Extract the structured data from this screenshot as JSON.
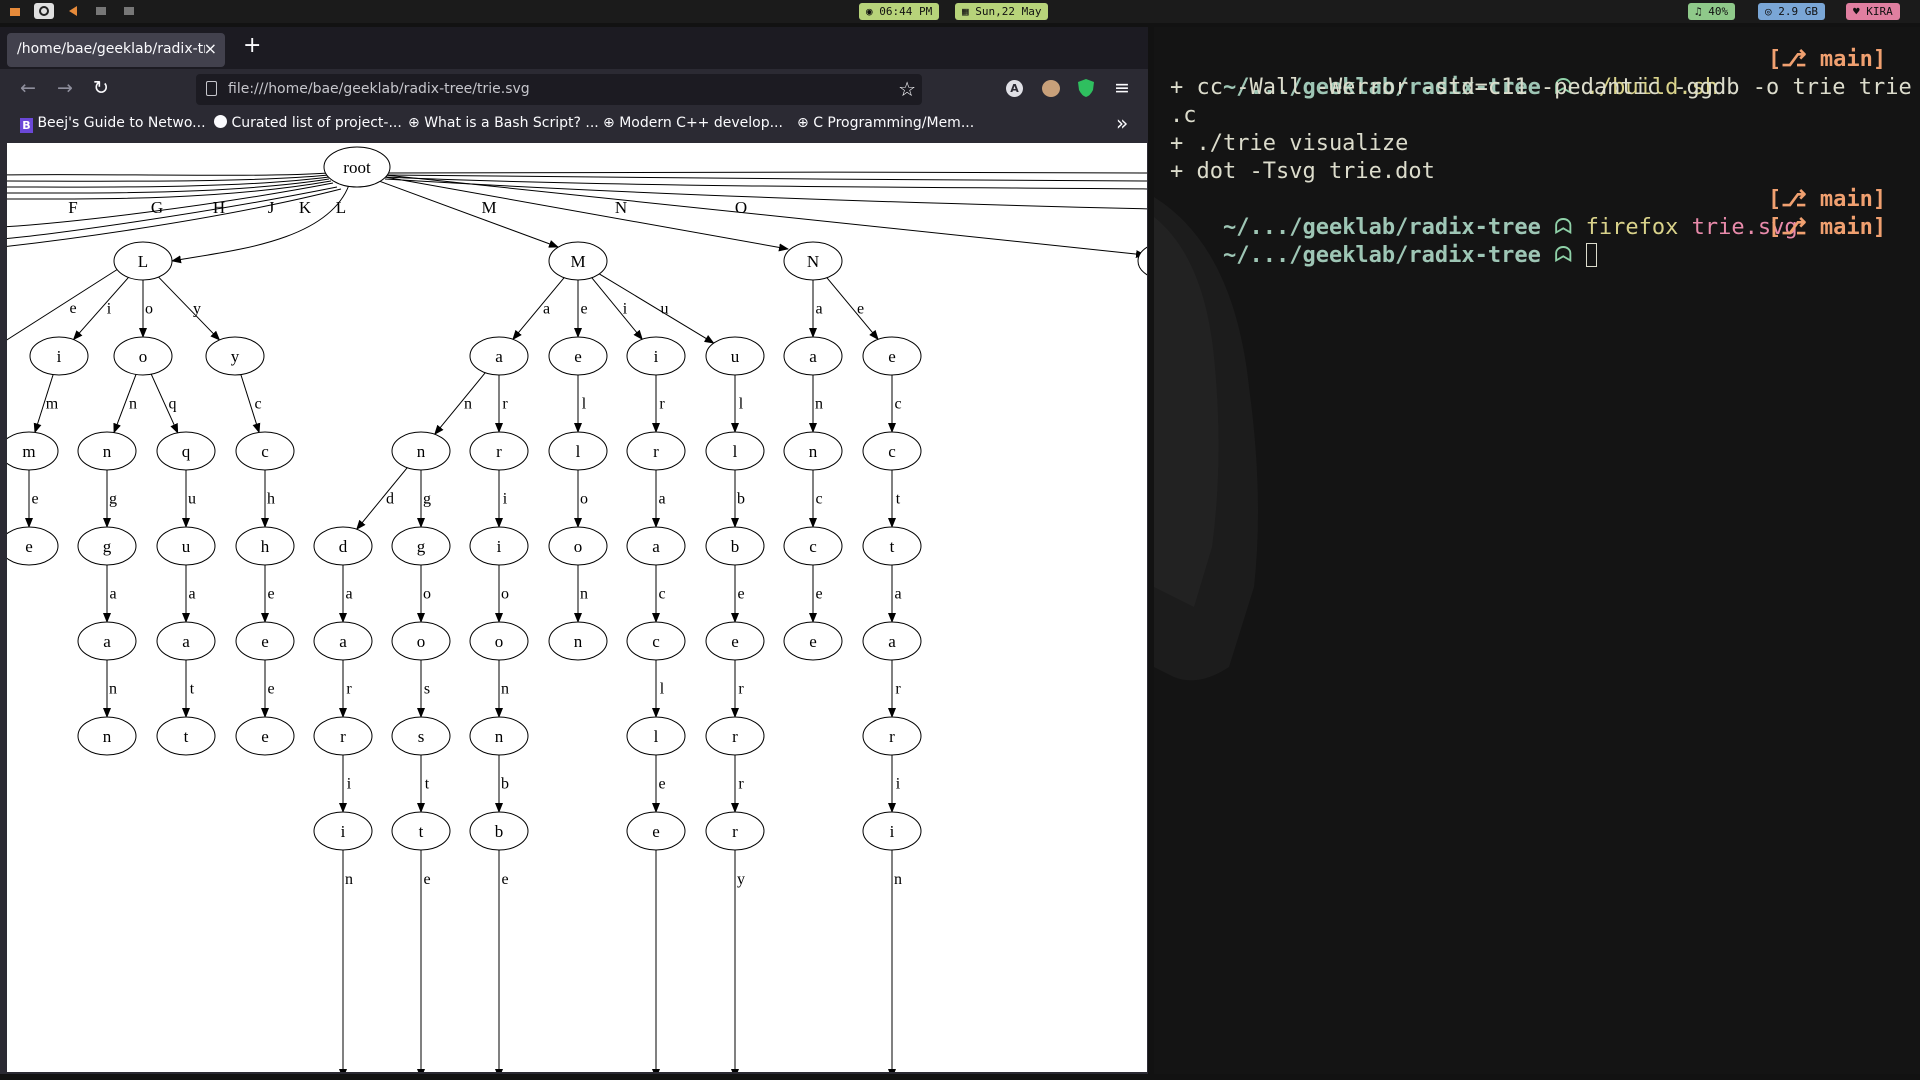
{
  "topbar": {
    "time": "06:44 PM",
    "date": "Sun,22 May",
    "audio": "40%",
    "memory": "2.9 GB",
    "user": "KIRA"
  },
  "browser": {
    "tab_title": "/home/bae/geeklab/radix-tree/trie.svg",
    "tab_close": "×",
    "new_tab": "+",
    "url": "file:///home/bae/geeklab/radix-tree/trie.svg",
    "bookmarks": [
      {
        "label": "Beej's Guide to Netwo..."
      },
      {
        "label": "Curated list of project-..."
      },
      {
        "label": "What is a Bash Script? ..."
      },
      {
        "label": "Modern C++ develop..."
      },
      {
        "label": "C Programming/Mem..."
      }
    ],
    "overflow": "»"
  },
  "graph": {
    "root": "root",
    "top_edge_labels": [
      "F",
      "G",
      "H",
      "J",
      "K",
      "L",
      "M",
      "N",
      "O"
    ],
    "nodes": [
      {
        "id": "L",
        "label": "L"
      },
      {
        "id": "M",
        "label": "M"
      },
      {
        "id": "N",
        "label": "N"
      },
      {
        "id": "Li",
        "label": "i"
      },
      {
        "id": "Lo",
        "label": "o"
      },
      {
        "id": "Ly",
        "label": "y"
      },
      {
        "id": "Lim",
        "label": "m"
      },
      {
        "id": "Lime",
        "label": "e"
      },
      {
        "id": "Lon",
        "label": "n"
      },
      {
        "id": "Long",
        "label": "g"
      },
      {
        "id": "Longa",
        "label": "a"
      },
      {
        "id": "Longan",
        "label": "n"
      },
      {
        "id": "Loq",
        "label": "q"
      },
      {
        "id": "Loqu",
        "label": "u"
      },
      {
        "id": "Loqua",
        "label": "a"
      },
      {
        "id": "Loquat",
        "label": "t"
      },
      {
        "id": "Lyc",
        "label": "c"
      },
      {
        "id": "Lych",
        "label": "h"
      },
      {
        "id": "Lyche",
        "label": "e"
      },
      {
        "id": "Lychee",
        "label": "e"
      },
      {
        "id": "Ma",
        "label": "a"
      },
      {
        "id": "Me",
        "label": "e"
      },
      {
        "id": "Mi",
        "label": "i"
      },
      {
        "id": "Mu",
        "label": "u"
      },
      {
        "id": "Man",
        "label": "n"
      },
      {
        "id": "Mand",
        "label": "d"
      },
      {
        "id": "Manda",
        "label": "a"
      },
      {
        "id": "Mandar",
        "label": "r"
      },
      {
        "id": "Mandari",
        "label": "i"
      },
      {
        "id": "Mang",
        "label": "g"
      },
      {
        "id": "Mango",
        "label": "o"
      },
      {
        "id": "Mangos",
        "label": "s"
      },
      {
        "id": "Mangost",
        "label": "t"
      },
      {
        "id": "Mar",
        "label": "r"
      },
      {
        "id": "Mari",
        "label": "i"
      },
      {
        "id": "Mario",
        "label": "o"
      },
      {
        "id": "Marion",
        "label": "n"
      },
      {
        "id": "Marionb",
        "label": "b"
      },
      {
        "id": "Mel",
        "label": "l"
      },
      {
        "id": "Melo",
        "label": "o"
      },
      {
        "id": "Melon",
        "label": "n"
      },
      {
        "id": "Mir",
        "label": "r"
      },
      {
        "id": "Mira",
        "label": "a"
      },
      {
        "id": "Mirac",
        "label": "c"
      },
      {
        "id": "Miracl",
        "label": "l"
      },
      {
        "id": "Miracle",
        "label": "e"
      },
      {
        "id": "Mul",
        "label": "l"
      },
      {
        "id": "Mulb",
        "label": "b"
      },
      {
        "id": "Mulbe",
        "label": "e"
      },
      {
        "id": "Mulber",
        "label": "r"
      },
      {
        "id": "Mulberr",
        "label": "r"
      },
      {
        "id": "Na",
        "label": "a"
      },
      {
        "id": "Nan",
        "label": "n"
      },
      {
        "id": "Nanc",
        "label": "c"
      },
      {
        "id": "Nance",
        "label": "e"
      },
      {
        "id": "Ne",
        "label": "e"
      },
      {
        "id": "Nec",
        "label": "c"
      },
      {
        "id": "Nect",
        "label": "t"
      },
      {
        "id": "Necta",
        "label": "a"
      },
      {
        "id": "Nectar",
        "label": "r"
      },
      {
        "id": "Nectari",
        "label": "i"
      }
    ],
    "edges": [
      {
        "from": "L",
        "to": "Li",
        "label": "i"
      },
      {
        "from": "L",
        "to": "Lo",
        "label": "o"
      },
      {
        "from": "L",
        "to": "Ly",
        "label": "y"
      },
      {
        "from": "Li",
        "to": "Lim",
        "label": "m"
      },
      {
        "from": "Lim",
        "to": "Lime",
        "label": "e"
      },
      {
        "from": "Lo",
        "to": "Lon",
        "label": "n"
      },
      {
        "from": "Lo",
        "to": "Loq",
        "label": "q"
      },
      {
        "from": "Lon",
        "to": "Long",
        "label": "g"
      },
      {
        "from": "Long",
        "to": "Longa",
        "label": "a"
      },
      {
        "from": "Longa",
        "to": "Longan",
        "label": "n"
      },
      {
        "from": "Loq",
        "to": "Loqu",
        "label": "u"
      },
      {
        "from": "Loqu",
        "to": "Loqua",
        "label": "a"
      },
      {
        "from": "Loqua",
        "to": "Loquat",
        "label": "t"
      },
      {
        "from": "Ly",
        "to": "Lyc",
        "label": "c"
      },
      {
        "from": "Lyc",
        "to": "Lych",
        "label": "h"
      },
      {
        "from": "Lych",
        "to": "Lyche",
        "label": "e"
      },
      {
        "from": "Lyche",
        "to": "Lychee",
        "label": "e"
      },
      {
        "from": "M",
        "to": "Ma",
        "label": "a"
      },
      {
        "from": "M",
        "to": "Me",
        "label": "e"
      },
      {
        "from": "M",
        "to": "Mi",
        "label": "i"
      },
      {
        "from": "M",
        "to": "Mu",
        "label": "u"
      },
      {
        "from": "Ma",
        "to": "Man",
        "label": "n"
      },
      {
        "from": "Ma",
        "to": "Mar",
        "label": "r"
      },
      {
        "from": "Man",
        "to": "Mand",
        "label": "d"
      },
      {
        "from": "Man",
        "to": "Mang",
        "label": "g"
      },
      {
        "from": "Mand",
        "to": "Manda",
        "label": "a"
      },
      {
        "from": "Manda",
        "to": "Mandar",
        "label": "r"
      },
      {
        "from": "Mandar",
        "to": "Mandari",
        "label": "i"
      },
      {
        "from": "Mang",
        "to": "Mango",
        "label": "o"
      },
      {
        "from": "Mango",
        "to": "Mangos",
        "label": "s"
      },
      {
        "from": "Mangos",
        "to": "Mangost",
        "label": "t"
      },
      {
        "from": "Mar",
        "to": "Mari",
        "label": "i"
      },
      {
        "from": "Mari",
        "to": "Mario",
        "label": "o"
      },
      {
        "from": "Mario",
        "to": "Marion",
        "label": "n"
      },
      {
        "from": "Marion",
        "to": "Marionb",
        "label": "b"
      },
      {
        "from": "Me",
        "to": "Mel",
        "label": "l"
      },
      {
        "from": "Mel",
        "to": "Melo",
        "label": "o"
      },
      {
        "from": "Melo",
        "to": "Melon",
        "label": "n"
      },
      {
        "from": "Mi",
        "to": "Mir",
        "label": "r"
      },
      {
        "from": "Mir",
        "to": "Mira",
        "label": "a"
      },
      {
        "from": "Mira",
        "to": "Mirac",
        "label": "c"
      },
      {
        "from": "Mirac",
        "to": "Miracl",
        "label": "l"
      },
      {
        "from": "Miracl",
        "to": "Miracle",
        "label": "e"
      },
      {
        "from": "Mu",
        "to": "Mul",
        "label": "l"
      },
      {
        "from": "Mul",
        "to": "Mulb",
        "label": "b"
      },
      {
        "from": "Mulb",
        "to": "Mulbe",
        "label": "e"
      },
      {
        "from": "Mulbe",
        "to": "Mulber",
        "label": "r"
      },
      {
        "from": "Mulber",
        "to": "Mulberr",
        "label": "r"
      },
      {
        "from": "N",
        "to": "Na",
        "label": "a"
      },
      {
        "from": "N",
        "to": "Ne",
        "label": "e"
      },
      {
        "from": "Na",
        "to": "Nan",
        "label": "n"
      },
      {
        "from": "Nan",
        "to": "Nanc",
        "label": "c"
      },
      {
        "from": "Nanc",
        "to": "Nance",
        "label": "e"
      },
      {
        "from": "Ne",
        "to": "Nec",
        "label": "c"
      },
      {
        "from": "Nec",
        "to": "Nect",
        "label": "t"
      },
      {
        "from": "Nect",
        "to": "Necta",
        "label": "a"
      },
      {
        "from": "Necta",
        "to": "Nectar",
        "label": "r"
      },
      {
        "from": "Nectar",
        "to": "Nectari",
        "label": "i"
      }
    ],
    "partial_edges": [
      {
        "from": "L",
        "label": "e"
      },
      {
        "from": "Mandari",
        "label": "n"
      },
      {
        "from": "Mangost",
        "label": "e"
      },
      {
        "from": "Marionb",
        "label": "e"
      },
      {
        "from": "Miracle",
        "label": ""
      },
      {
        "from": "Mulberr",
        "label": "y"
      },
      {
        "from": "Nectari",
        "label": "n"
      }
    ]
  },
  "terminal": {
    "path": "~/.../geeklab/radix-tree",
    "prompt_glyph": "ᗣ",
    "branch": "[⎇ main]",
    "cmd1": "./build.sh",
    "out1": "+ cc -Wall -Werror -std=c11 -pedantic -ggdb -o trie trie",
    "out1b": ".c",
    "out2": "+ ./trie visualize",
    "out3": "+ dot -Tsvg trie.dot",
    "cmd2_program": "firefox",
    "cmd2_arg": "trie.svg"
  }
}
